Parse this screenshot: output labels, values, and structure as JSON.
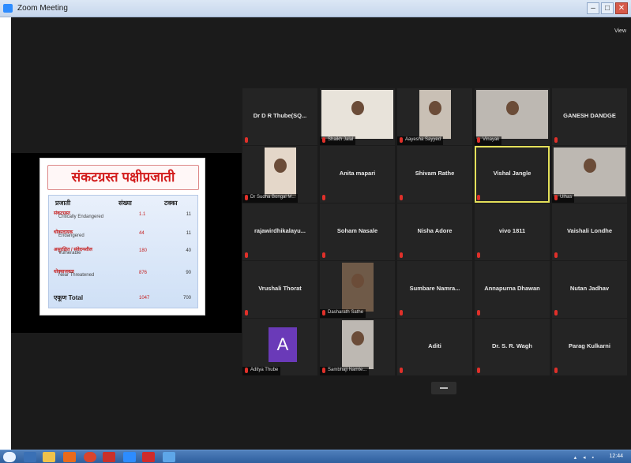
{
  "window": {
    "title": "Zoom Meeting",
    "minimize": "–",
    "maximize": "□",
    "close": "✕"
  },
  "view_label": "View",
  "slide": {
    "title": "संकटग्रस्त पक्षीप्रजाती",
    "headers": [
      "प्रजाती",
      "संख्या",
      "टक्का"
    ],
    "rows": [
      {
        "category": "संकटग्रस्त",
        "sub": "Critically Endangered",
        "n1": "1.1",
        "n2": "11"
      },
      {
        "category": "धोकादायक",
        "sub": "Endangered",
        "n1": "44",
        "n2": "11"
      },
      {
        "category": "असुरक्षित / संवेदनशील",
        "sub": "Vulnerable",
        "n1": "180",
        "n2": "40"
      },
      {
        "category": "धोक्याजवळ",
        "sub": "Near Threatened",
        "n1": "876",
        "n2": "90"
      }
    ],
    "total": {
      "label": "एकूण Total",
      "n1": "1047",
      "n2": "700"
    }
  },
  "participants": [
    {
      "name": "Dr D R Thube(SQ...",
      "video": false
    },
    {
      "name": "Shaikh Jalal",
      "video": true
    },
    {
      "name": "Aayesha Sayyed",
      "video": true
    },
    {
      "name": "Vinayak",
      "video": true
    },
    {
      "name": "GANESH DANDGE",
      "video": false
    },
    {
      "name": "Dr Sudha Bongal M...",
      "video": true
    },
    {
      "name": "Anita mapari",
      "video": false
    },
    {
      "name": "Shivam Rathe",
      "video": false
    },
    {
      "name": "Vishal Jangle",
      "video": false,
      "active": true
    },
    {
      "name": "Ulhas",
      "video": true
    },
    {
      "name": "rajawirdhikalayu...",
      "video": false
    },
    {
      "name": "Soham Nasale",
      "video": false
    },
    {
      "name": "Nisha Adore",
      "video": false
    },
    {
      "name": "vivo 1811",
      "video": false
    },
    {
      "name": "Vaishali Londhe",
      "video": false
    },
    {
      "name": "Vrushali Thorat",
      "video": false
    },
    {
      "name": "Dasharath Sathe",
      "video": true
    },
    {
      "name": "Sumbare Namra...",
      "video": false
    },
    {
      "name": "Annapurna Dhawan",
      "video": false
    },
    {
      "name": "Nutan Jadhav",
      "video": false
    },
    {
      "name": "Aditya Thube",
      "video": false,
      "letter": "A"
    },
    {
      "name": "Sambhaji Namte...",
      "video": true
    },
    {
      "name": "Aditi",
      "video": false
    },
    {
      "name": "Dr. S. R. Wagh",
      "video": false
    },
    {
      "name": "Parag Kulkarni",
      "video": false
    }
  ],
  "taskbar": {
    "clock": "12:44",
    "tray": "▴ ◂ ▪"
  },
  "colors": {
    "active_outline": "#e4e05a",
    "mic_muted": "#e0302a",
    "slide_title": "#d21c1c"
  }
}
